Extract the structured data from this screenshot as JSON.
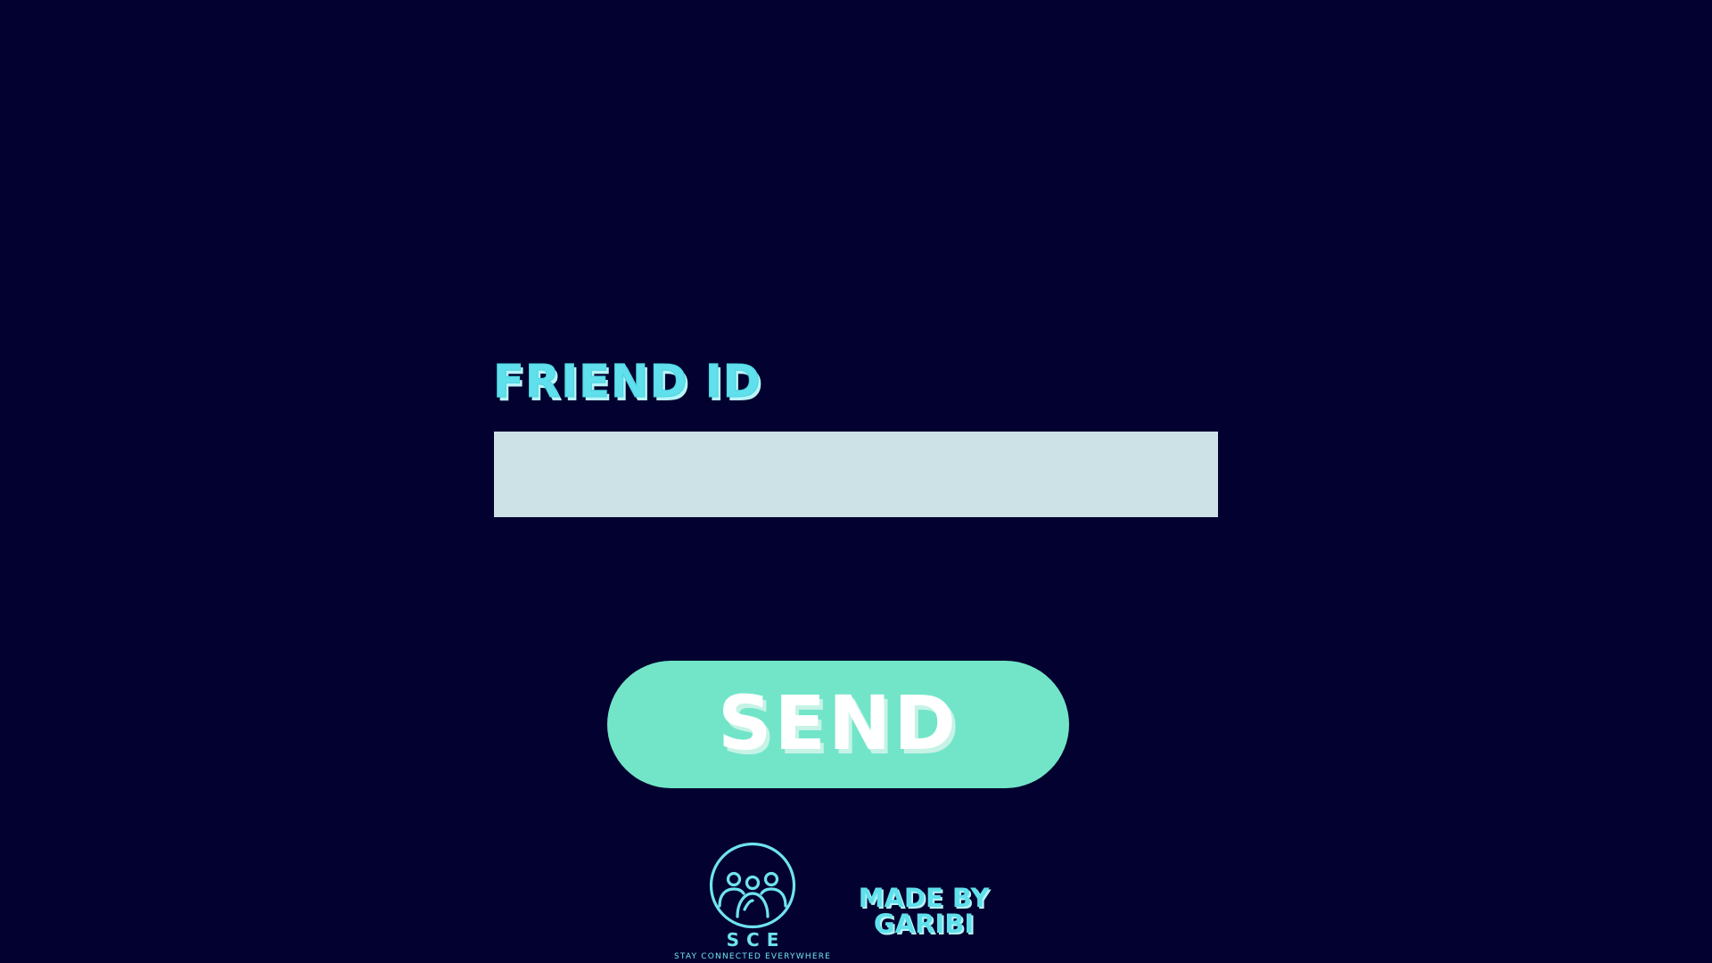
{
  "form": {
    "label": "FRIEND ID",
    "input_value": "",
    "input_placeholder": ""
  },
  "actions": {
    "send_label": "SEND"
  },
  "footer": {
    "logo": {
      "icon": "people-group-circle-icon",
      "name": "SCE",
      "tagline": "STAY CONNECTED EVERYWHERE"
    },
    "credit": {
      "line1": "MADE BY",
      "line2": "GARIBI"
    }
  },
  "colors": {
    "background": "#03012f",
    "accent_cyan": "#5fe0ec",
    "input_fill": "#cde2e7",
    "button_fill": "#72e5c9",
    "button_text": "#ffffff"
  }
}
